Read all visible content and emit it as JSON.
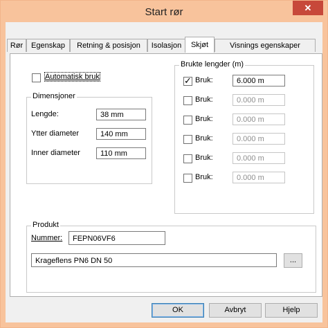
{
  "window": {
    "title": "Start rør",
    "close_glyph": "✕"
  },
  "tabs": [
    {
      "label": "Rør"
    },
    {
      "label": "Egenskap"
    },
    {
      "label": "Retning & posisjon"
    },
    {
      "label": "Isolasjon"
    },
    {
      "label": "Skjøt",
      "active": true
    },
    {
      "label": "Visnings egenskaper"
    }
  ],
  "auto_use": {
    "label": "Automatisk bruk",
    "checked": false
  },
  "dimensions": {
    "group_label": "Dimensjoner",
    "rows": [
      {
        "label": "Lengde:",
        "value": "38 mm"
      },
      {
        "label": "Ytter diameter",
        "value": "140 mm"
      },
      {
        "label": "Inner diameter",
        "value": "110 mm"
      }
    ]
  },
  "used_lengths": {
    "group_label": "Brukte lengder (m)",
    "rows": [
      {
        "label": "Bruk:",
        "checked": true,
        "value": "6.000 m"
      },
      {
        "label": "Bruk:",
        "checked": false,
        "value": "0.000 m"
      },
      {
        "label": "Bruk:",
        "checked": false,
        "value": "0.000 m"
      },
      {
        "label": "Bruk:",
        "checked": false,
        "value": "0.000 m"
      },
      {
        "label": "Bruk:",
        "checked": false,
        "value": "0.000 m"
      },
      {
        "label": "Bruk:",
        "checked": false,
        "value": "0.000 m"
      }
    ]
  },
  "product": {
    "group_label": "Produkt",
    "number_label": "Nummer:",
    "number_value": "FEPN06VF6",
    "description": "Krageflens PN6 DN 50",
    "browse_label": "..."
  },
  "buttons": {
    "ok": "OK",
    "cancel": "Avbryt",
    "help": "Hjelp"
  },
  "colors": {
    "frame": "#f8c39c",
    "close": "#c7483a",
    "panel": "#ffffff",
    "dialog": "#f0f0f0"
  }
}
